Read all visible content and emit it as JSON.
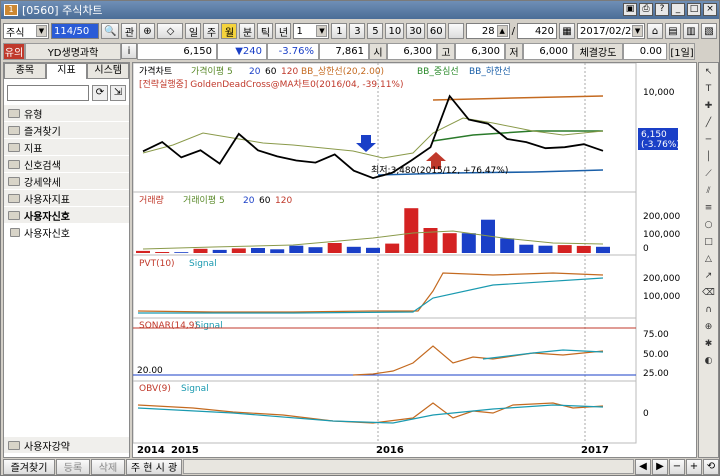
{
  "window": {
    "title": "[0560] 주식차트"
  },
  "toolbar": {
    "market": "주식",
    "code": "114/50",
    "buttons": [
      "일",
      "주",
      "월",
      "분",
      "틱",
      "년"
    ],
    "active": "월",
    "period_sel": "1",
    "minute_opts": [
      "1",
      "3",
      "5",
      "10",
      "30",
      "60"
    ],
    "count": "28",
    "total": "420",
    "date": "2017/02/20"
  },
  "quote": {
    "tag": "유의",
    "name": "YD생명과학",
    "price": "6,150",
    "change": "▼240",
    "pct": "-3.76%",
    "volume": "7,861",
    "open_lbl": "시",
    "open": "6,300",
    "high_lbl": "고",
    "high": "6,300",
    "low_lbl": "저",
    "low": "6,000",
    "strength_lbl": "체결강도",
    "strength": "0.00",
    "unit": "[1일]"
  },
  "sidebar": {
    "tabs": [
      "종목",
      "지표",
      "시스템"
    ],
    "items": [
      "유형",
      "즐겨찾기",
      "지표",
      "신호검색",
      "강세약세",
      "사용자지표",
      "사용자신호"
    ],
    "child": "사용자신호",
    "bottom": "사용자강약"
  },
  "bottom": {
    "buttons": [
      "즐겨찾기",
      "등록",
      "삭제"
    ],
    "tabs": "주 현 시 광"
  },
  "chart": {
    "price_legend": [
      "가격차트",
      "가격이평 5",
      "20",
      "60",
      "120",
      "BB_상한선(20,2.00)",
      "BB_중심선",
      "BB_하한선"
    ],
    "strategy": "[전략실행중] GoldenDeadCross@MA차트0(2016/04, -39.11%)",
    "low_note": "최저:3,480(2015/12, +76.47%)",
    "price_ticks": [
      "10,000",
      "5,000"
    ],
    "last_price": "6,150",
    "last_pct": "(-3.76%)",
    "vol_legend": [
      "거래량",
      "거래이평 5",
      "20",
      "60",
      "120"
    ],
    "vol_ticks": [
      "200,000",
      "100,000",
      "0"
    ],
    "pvt_legend": [
      "PVT(10)",
      "Signal"
    ],
    "pvt_ticks": [
      "200,000",
      "100,000"
    ],
    "stoch_legend": [
      "SONAR(14,9)",
      "Signal"
    ],
    "stoch_ticks": [
      "75.00",
      "50.00",
      "25.00"
    ],
    "stoch_min": "20.00",
    "obv_legend": [
      "OBV(9)",
      "Signal"
    ],
    "obv_ticks": [
      "0"
    ],
    "x_labels": [
      "2014",
      "2015",
      "2016",
      "2017"
    ]
  },
  "chart_data": {
    "type": "line",
    "x_labels": [
      "2014",
      "2015",
      "2016",
      "2017"
    ],
    "price_close": [
      6100,
      7000,
      5500,
      6200,
      4900,
      7800,
      6200,
      5600,
      5200,
      5000,
      5800,
      4200,
      3480,
      4000,
      5200,
      6500,
      11500,
      9200,
      8800,
      7300,
      7000,
      6400,
      6500,
      6800,
      6150
    ],
    "volume_bars": [
      10000,
      5000,
      4000,
      20000,
      15000,
      22000,
      24000,
      18000,
      35000,
      28000,
      48000,
      30000,
      25000,
      45000,
      215000,
      120000,
      95000,
      95000,
      160000,
      70000,
      40000,
      35000,
      38000,
      34000,
      30000
    ]
  }
}
